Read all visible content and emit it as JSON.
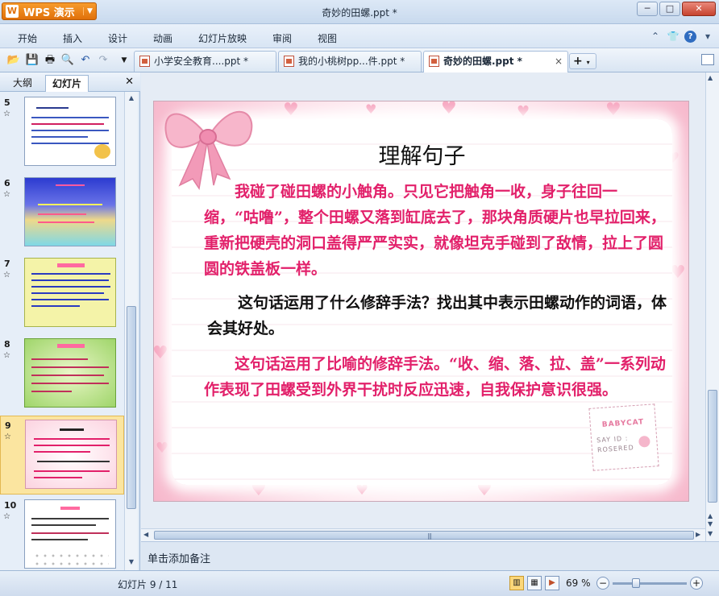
{
  "window": {
    "app_button": "WPS 演示",
    "title": "奇妙的田螺.ppt *"
  },
  "menu": [
    "开始",
    "插入",
    "设计",
    "动画",
    "幻灯片放映",
    "审阅",
    "视图"
  ],
  "tabs": [
    {
      "label": "小学安全教育....ppt *"
    },
    {
      "label": "我的小桃树pp...件.ppt *"
    },
    {
      "label": "奇妙的田螺.ppt *"
    }
  ],
  "left_panel": {
    "tab_outline": "大纲",
    "tab_slides": "幻灯片",
    "slide_numbers": [
      "5",
      "6",
      "7",
      "8",
      "9",
      "10"
    ]
  },
  "slide": {
    "title": "理解句子",
    "para1": "我碰了碰田螺的小触角。只见它把触角一收，身子往回一缩，“咕噜”，整个田螺又落到缸底去了，那块角质硬片也早拉回来，重新把硬壳的洞口盖得严严实实，就像坦克手碰到了敌情，拉上了圆圆的铁盖板一样。",
    "para2": "这句话运用了什么修辞手法？找出其中表示田螺动作的词语，体会其好处。",
    "para3": "这句话运用了比喻的修辞手法。“收、缩、落、拉、盖”一系列动作表现了田螺受到外界干扰时反应迅速，自我保护意识很强。",
    "stamp_brand": "BABYCAT",
    "stamp_line1": "SAY ID :",
    "stamp_line2": "ROSERED"
  },
  "notes_placeholder": "单击添加备注",
  "status": {
    "slide_indicator": "幻灯片 9 / 11",
    "zoom": "69 %"
  }
}
